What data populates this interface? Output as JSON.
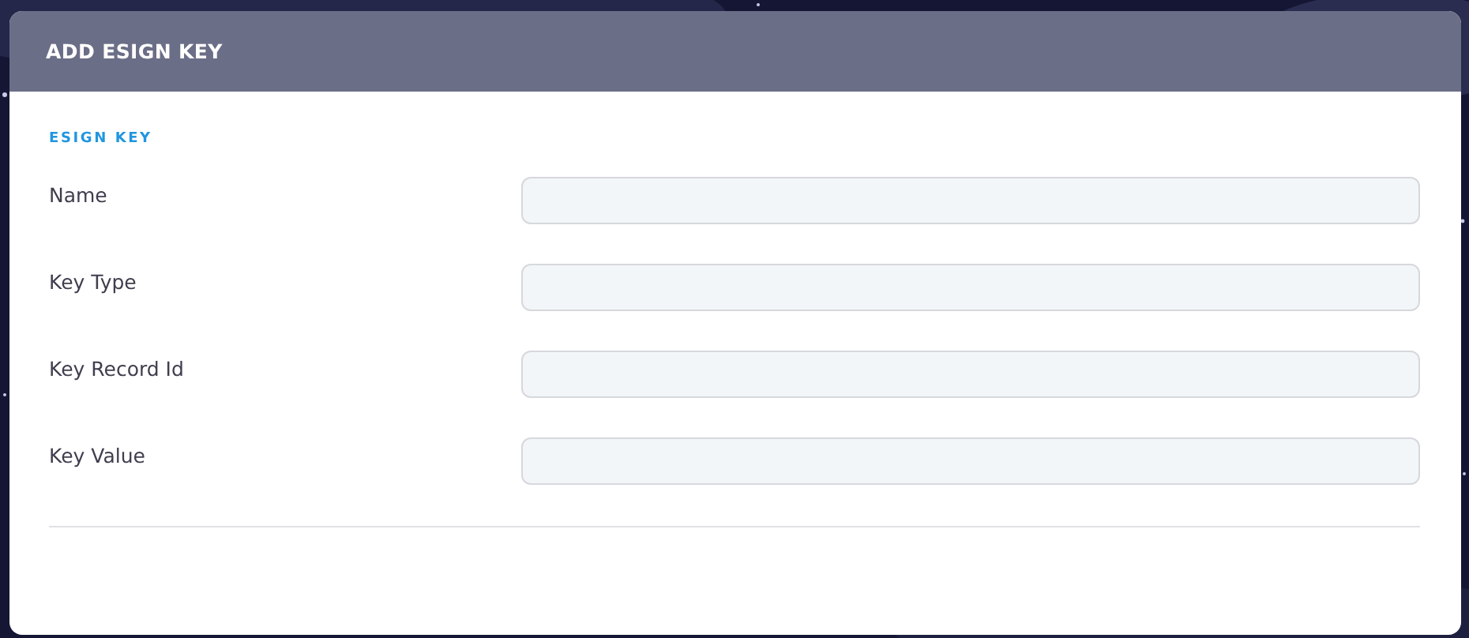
{
  "dialog": {
    "title": "ADD ESIGN KEY"
  },
  "section": {
    "title": "ESIGN KEY"
  },
  "fields": [
    {
      "label": "Name"
    },
    {
      "label": "Key Type"
    },
    {
      "label": "Key Record Id"
    },
    {
      "label": "Key Value"
    }
  ]
}
